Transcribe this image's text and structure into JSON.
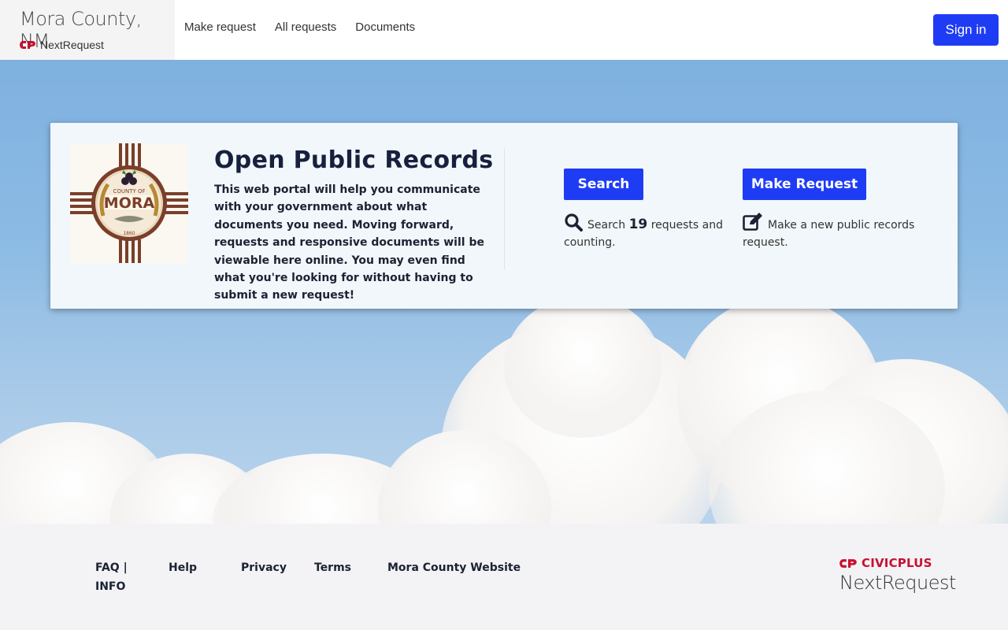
{
  "header": {
    "org_name": "Mora County, NM",
    "product_name": "NextRequest",
    "nav": [
      {
        "label": "Make request"
      },
      {
        "label": "All requests"
      },
      {
        "label": "Documents"
      }
    ],
    "signin_label": "Sign in"
  },
  "hero": {
    "seal": {
      "top_text": "COUNTY OF",
      "name": "MORA",
      "year": "1860"
    },
    "title": "Open Public Records",
    "description": "This web portal will help you communicate with your government about what documents you need. Moving forward, requests and responsive documents will be viewable here online. You may even find what you're looking for without having to submit a new request!",
    "search": {
      "button_label": "Search",
      "prefix": "Search",
      "count": "19",
      "suffix": "requests and counting."
    },
    "make_request": {
      "button_label": "Make Request",
      "text": "Make a new public records request."
    }
  },
  "footer": {
    "links": [
      {
        "label": "FAQ | INFO"
      },
      {
        "label": "Help"
      },
      {
        "label": "Privacy"
      },
      {
        "label": "Terms"
      },
      {
        "label": "Mora County Website"
      }
    ],
    "brand_top": "CIVICPLUS",
    "brand_bottom": "NextRequest"
  },
  "colors": {
    "accent": "#1f3cf5",
    "civicplus_red": "#c8102e",
    "heading": "#16213e"
  },
  "icons": [
    "civicplus-logo-icon",
    "search-icon",
    "edit-icon"
  ]
}
